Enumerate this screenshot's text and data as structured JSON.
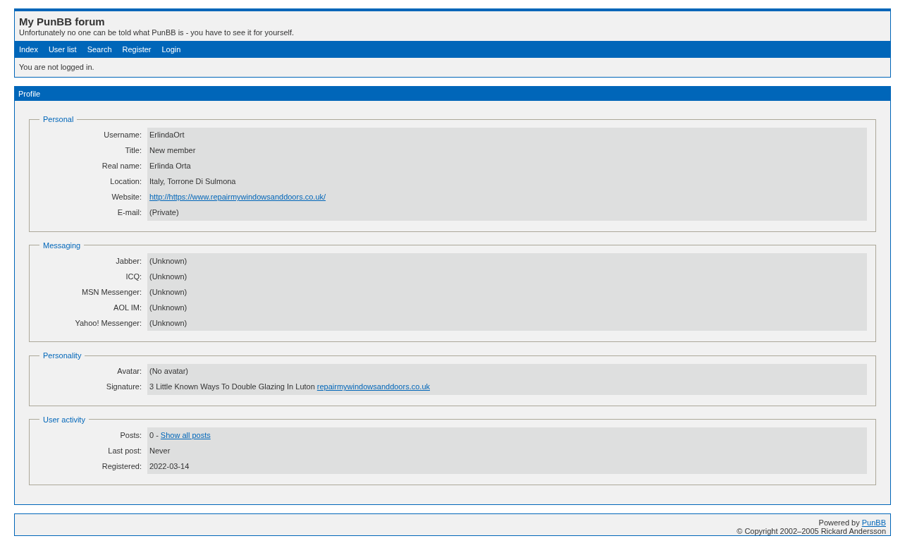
{
  "header": {
    "title": "My PunBB forum",
    "description": "Unfortunately no one can be told what PunBB is - you have to see it for yourself."
  },
  "nav": [
    "Index",
    "User list",
    "Search",
    "Register",
    "Login"
  ],
  "status": "You are not logged in.",
  "profile": {
    "title": "Profile",
    "sections": [
      {
        "legend": "Personal",
        "rows": [
          {
            "label": "Username:",
            "value": [
              {
                "kind": "text",
                "text": "ErlindaOrt"
              }
            ]
          },
          {
            "label": "Title:",
            "value": [
              {
                "kind": "text",
                "text": "New member"
              }
            ]
          },
          {
            "label": "Real name:",
            "value": [
              {
                "kind": "text",
                "text": "Erlinda Orta"
              }
            ]
          },
          {
            "label": "Location:",
            "value": [
              {
                "kind": "text",
                "text": "Italy, Torrone Di Sulmona"
              }
            ]
          },
          {
            "label": "Website:",
            "value": [
              {
                "kind": "link",
                "text": "http://https://www.repairmywindowsanddoors.co.uk/"
              }
            ]
          },
          {
            "label": "E-mail:",
            "value": [
              {
                "kind": "text",
                "text": "(Private)"
              }
            ]
          }
        ]
      },
      {
        "legend": "Messaging",
        "rows": [
          {
            "label": "Jabber:",
            "value": [
              {
                "kind": "text",
                "text": "(Unknown)"
              }
            ]
          },
          {
            "label": "ICQ:",
            "value": [
              {
                "kind": "text",
                "text": "(Unknown)"
              }
            ]
          },
          {
            "label": "MSN Messenger:",
            "value": [
              {
                "kind": "text",
                "text": "(Unknown)"
              }
            ]
          },
          {
            "label": "AOL IM:",
            "value": [
              {
                "kind": "text",
                "text": "(Unknown)"
              }
            ]
          },
          {
            "label": "Yahoo! Messenger:",
            "value": [
              {
                "kind": "text",
                "text": "(Unknown)"
              }
            ]
          }
        ]
      },
      {
        "legend": "Personality",
        "rows": [
          {
            "label": "Avatar:",
            "value": [
              {
                "kind": "text",
                "text": "(No avatar)"
              }
            ]
          },
          {
            "label": "Signature:",
            "value": [
              {
                "kind": "text",
                "text": "3 Little Known Ways To Double Glazing In Luton"
              },
              {
                "kind": "link",
                "text": "repairmywindowsanddoors.co.uk"
              }
            ]
          }
        ]
      },
      {
        "legend": "User activity",
        "rows": [
          {
            "label": "Posts:",
            "value": [
              {
                "kind": "text",
                "text": "0 -"
              },
              {
                "kind": "link",
                "text": "Show all posts"
              }
            ]
          },
          {
            "label": "Last post:",
            "value": [
              {
                "kind": "text",
                "text": "Never"
              }
            ]
          },
          {
            "label": "Registered:",
            "value": [
              {
                "kind": "text",
                "text": "2022-03-14"
              }
            ]
          }
        ]
      }
    ]
  },
  "footer": {
    "powered_by": "Powered by",
    "powered_link": "PunBB",
    "copyright": "© Copyright 2002–2005 Rickard Andersson"
  }
}
